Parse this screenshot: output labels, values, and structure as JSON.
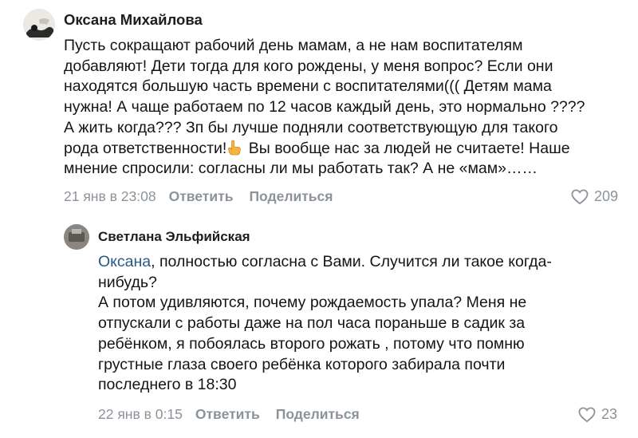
{
  "comments": [
    {
      "author": "Оксана Михайлова",
      "lines": [
        "Пусть сокращают рабочий день мамам, а не нам воспитателям",
        "добавляют! Дети тогда для кого рождены, у меня вопрос? Если они",
        "находятся большую часть времени с воспитателями((( Детям мама",
        "нужна! А чаще работаем по 12 часов каждый день, это нормально ????",
        "А жить когда??? Зп бы лучше подняли соответствующую для такого",
        "рода ответственности!",
        "Вы вообще нас за людей не считаете! Наше",
        "мнение спросили: согласны ли мы работать так? А не «мам»……"
      ],
      "emoji_icon": "pointing-hand-icon",
      "date": "21 янв в 23:08",
      "reply_label": "Ответить",
      "share_label": "Поделиться",
      "likes": "209"
    },
    {
      "author": "Светлана Эльфийская",
      "mention": "Оксана",
      "lines": [
        ", полностью согласна с Вами. Случится ли такое когда-",
        "нибудь?",
        "А потом удивляются, почему рождаемость упала? Меня не",
        "отпускали с работы даже на пол часа пораньше в садик за",
        "ребёнком, я побоялась второго рожать , потому что помню",
        "грустные глаза своего ребёнка которого забирала почти",
        "последнего в 18:30"
      ],
      "date": "22 янв в 0:15",
      "reply_label": "Ответить",
      "share_label": "Поделиться",
      "likes": "23"
    }
  ],
  "colors": {
    "text": "#141414",
    "meta": "#8c9299",
    "mention": "#2a5885"
  },
  "icons": {
    "like": "heart-outline-icon"
  }
}
